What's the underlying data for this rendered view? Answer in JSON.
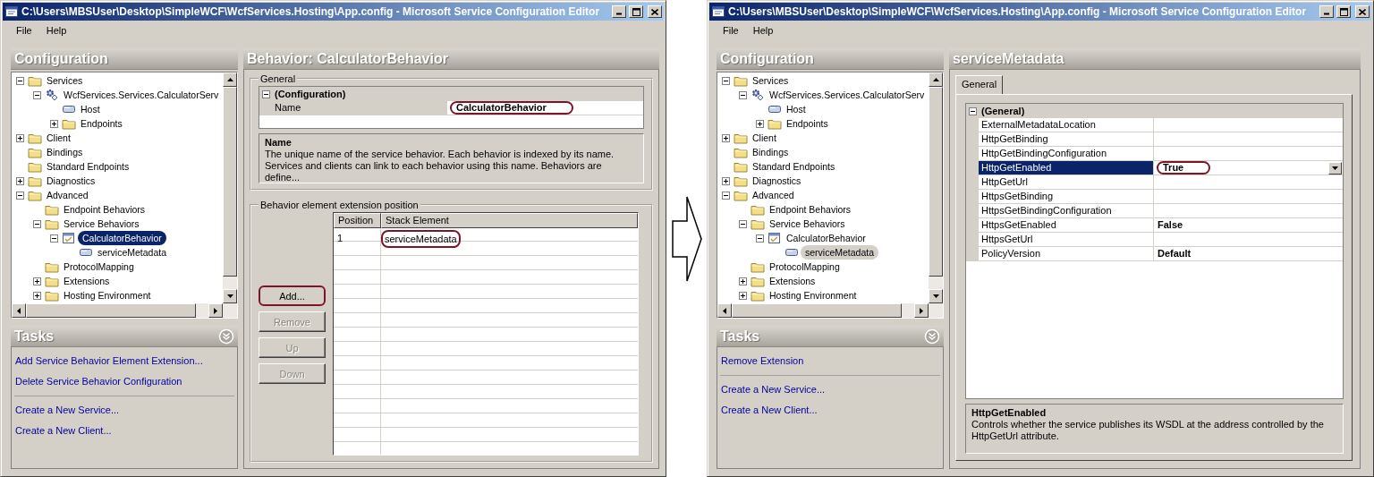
{
  "windows": [
    {
      "title": "C:\\Users\\MBSUser\\Desktop\\SimpleWCF\\WcfServices.Hosting\\App.config - Microsoft Service Configuration Editor",
      "menu": [
        "File",
        "Help"
      ],
      "tree": {
        "header": "Configuration",
        "focused": true,
        "items": [
          {
            "label": "Services",
            "kind": "folder",
            "expanded": true,
            "selected": false,
            "children": [
              {
                "label": "WcfServices.Services.CalculatorServ",
                "kind": "service",
                "expanded": true,
                "selected": false,
                "children": [
                  {
                    "label": "Host",
                    "kind": "node",
                    "selected": false
                  },
                  {
                    "label": "Endpoints",
                    "kind": "folder",
                    "expanded": false,
                    "selected": false
                  }
                ]
              }
            ]
          },
          {
            "label": "Client",
            "kind": "folder",
            "expanded": false,
            "selected": false
          },
          {
            "label": "Bindings",
            "kind": "folder",
            "selected": false
          },
          {
            "label": "Standard Endpoints",
            "kind": "folder",
            "selected": false
          },
          {
            "label": "Diagnostics",
            "kind": "folder",
            "expanded": false,
            "selected": false
          },
          {
            "label": "Advanced",
            "kind": "folder",
            "expanded": true,
            "selected": false,
            "children": [
              {
                "label": "Endpoint Behaviors",
                "kind": "folder",
                "selected": false
              },
              {
                "label": "Service Behaviors",
                "kind": "folder",
                "expanded": true,
                "selected": false,
                "children": [
                  {
                    "label": "CalculatorBehavior",
                    "kind": "behavior",
                    "expanded": true,
                    "selected": true,
                    "circled": true,
                    "children": [
                      {
                        "label": "serviceMetadata",
                        "kind": "node",
                        "selected": false
                      }
                    ]
                  }
                ]
              },
              {
                "label": "ProtocolMapping",
                "kind": "folder",
                "selected": false
              },
              {
                "label": "Extensions",
                "kind": "folder",
                "expanded": false,
                "selected": false
              },
              {
                "label": "Hosting Environment",
                "kind": "folder",
                "expanded": false,
                "selected": false
              }
            ]
          }
        ]
      },
      "tasks": {
        "header": "Tasks",
        "groups": [
          [
            "Add Service Behavior Element Extension...",
            "Delete Service Behavior Configuration"
          ],
          [
            "Create a New Service...",
            "Create a New Client..."
          ]
        ]
      },
      "detail": {
        "kind": "behavior",
        "header": "Behavior: CalculatorBehavior",
        "general": {
          "legend": "General",
          "grid": {
            "focused": false,
            "category": "(Configuration)",
            "expanded": true,
            "rows": [
              {
                "name": "Name",
                "value": "CalculatorBehavior",
                "selected": true,
                "circled": true
              }
            ]
          },
          "description": {
            "title": "Name",
            "text": "The unique name of the service behavior. Each behavior is indexed by its name. Services and clients can link to each behavior using this name. Behaviors are define..."
          }
        },
        "extensions": {
          "legend": "Behavior element extension position",
          "buttons": [
            {
              "label": "Add...",
              "disabled": false,
              "circled": true
            },
            {
              "label": "Remove",
              "disabled": true
            },
            {
              "label": "Up",
              "disabled": true
            },
            {
              "label": "Down",
              "disabled": true
            }
          ],
          "columns": [
            "Position",
            "Stack Element"
          ],
          "rows": [
            {
              "cells": [
                {
                  "text": "1"
                },
                {
                  "text": "serviceMetadata",
                  "circled": true
                }
              ]
            }
          ]
        }
      }
    },
    {
      "title": "C:\\Users\\MBSUser\\Desktop\\SimpleWCF\\WcfServices.Hosting\\App.config - Microsoft Service Configuration Editor",
      "menu": [
        "File",
        "Help"
      ],
      "tree": {
        "header": "Configuration",
        "focused": false,
        "items": [
          {
            "label": "Services",
            "kind": "folder",
            "expanded": true,
            "selected": false,
            "children": [
              {
                "label": "WcfServices.Services.CalculatorServ",
                "kind": "service",
                "expanded": true,
                "selected": false,
                "children": [
                  {
                    "label": "Host",
                    "kind": "node",
                    "selected": false
                  },
                  {
                    "label": "Endpoints",
                    "kind": "folder",
                    "expanded": false,
                    "selected": false
                  }
                ]
              }
            ]
          },
          {
            "label": "Client",
            "kind": "folder",
            "expanded": false,
            "selected": false
          },
          {
            "label": "Bindings",
            "kind": "folder",
            "selected": false
          },
          {
            "label": "Standard Endpoints",
            "kind": "folder",
            "selected": false
          },
          {
            "label": "Diagnostics",
            "kind": "folder",
            "expanded": false,
            "selected": false
          },
          {
            "label": "Advanced",
            "kind": "folder",
            "expanded": true,
            "selected": false,
            "children": [
              {
                "label": "Endpoint Behaviors",
                "kind": "folder",
                "selected": false
              },
              {
                "label": "Service Behaviors",
                "kind": "folder",
                "expanded": true,
                "selected": false,
                "children": [
                  {
                    "label": "CalculatorBehavior",
                    "kind": "behavior",
                    "expanded": true,
                    "selected": false,
                    "children": [
                      {
                        "label": "serviceMetadata",
                        "kind": "node",
                        "selected": true,
                        "circled": true
                      }
                    ]
                  }
                ]
              },
              {
                "label": "ProtocolMapping",
                "kind": "folder",
                "selected": false
              },
              {
                "label": "Extensions",
                "kind": "folder",
                "expanded": false,
                "selected": false
              },
              {
                "label": "Hosting Environment",
                "kind": "folder",
                "expanded": false,
                "selected": false
              }
            ]
          }
        ]
      },
      "tasks": {
        "header": "Tasks",
        "groups": [
          [
            "Remove Extension"
          ],
          [
            "Create a New Service...",
            "Create a New Client..."
          ]
        ]
      },
      "detail": {
        "kind": "properties",
        "header": "serviceMetadata",
        "tabs": [
          {
            "label": "General",
            "selected": true
          }
        ],
        "grid": {
          "focused": true,
          "category": "(General)",
          "expanded": true,
          "rows": [
            {
              "name": "ExternalMetadataLocation",
              "selected": false
            },
            {
              "name": "HttpGetBinding",
              "selected": false
            },
            {
              "name": "HttpGetBindingConfiguration",
              "selected": false
            },
            {
              "name": "HttpGetEnabled",
              "value": "True",
              "selected": true,
              "circled": true
            },
            {
              "name": "HttpGetUrl",
              "selected": false
            },
            {
              "name": "HttpsGetBinding",
              "selected": false
            },
            {
              "name": "HttpsGetBindingConfiguration",
              "selected": false
            },
            {
              "name": "HttpsGetEnabled",
              "value": "False",
              "selected": false
            },
            {
              "name": "HttpsGetUrl",
              "selected": false
            },
            {
              "name": "PolicyVersion",
              "value": "Default",
              "selected": false
            }
          ]
        },
        "description": {
          "title": "HttpGetEnabled",
          "text": "Controls whether the service publishes its WSDL at the address controlled by the HttpGetUrl attribute."
        }
      }
    }
  ]
}
